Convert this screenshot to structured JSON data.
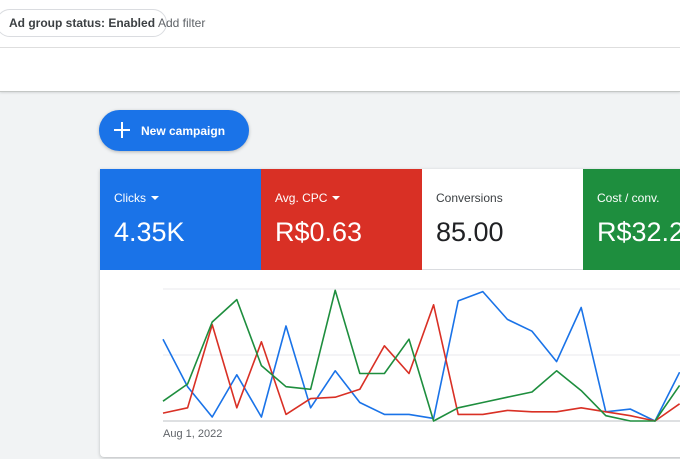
{
  "filter_bar": {
    "chip_key": "Ad group status:",
    "chip_value": "Enabled",
    "add_filter": "Add filter"
  },
  "new_campaign": {
    "label": "New campaign",
    "icon": "plus-icon"
  },
  "scorecards": [
    {
      "label": "Clicks",
      "value": "4.35K",
      "color": "#1a73e8",
      "dropdown": true
    },
    {
      "label": "Avg. CPC",
      "value": "R$0.63",
      "color": "#d93025",
      "dropdown": true
    },
    {
      "label": "Conversions",
      "value": "85.00",
      "color": "#ffffff",
      "dropdown": false
    },
    {
      "label": "Cost / conv.",
      "value": "R$32.2",
      "color": "#1e8e3e",
      "dropdown": false
    }
  ],
  "chart_data": {
    "type": "line",
    "x_start_label": "Aug 1, 2022",
    "grid": true,
    "ylim": [
      0,
      100
    ],
    "series": [
      {
        "color": "#1a73e8",
        "values": [
          62,
          26,
          3,
          35,
          3,
          72,
          10,
          38,
          14,
          5,
          5,
          2,
          91,
          98,
          77,
          68,
          45,
          86,
          7,
          9,
          0,
          37
        ]
      },
      {
        "color": "#d93025",
        "values": [
          6,
          10,
          73,
          10,
          60,
          5,
          17,
          18,
          24,
          57,
          36,
          88,
          5,
          5,
          8,
          7,
          7,
          10,
          7,
          4,
          0,
          13
        ]
      },
      {
        "color": "#1e8e3e",
        "values": [
          15,
          28,
          75,
          92,
          42,
          26,
          24,
          99,
          36,
          36,
          62,
          0,
          10,
          14,
          18,
          22,
          38,
          23,
          4,
          0,
          0,
          27
        ]
      }
    ]
  }
}
